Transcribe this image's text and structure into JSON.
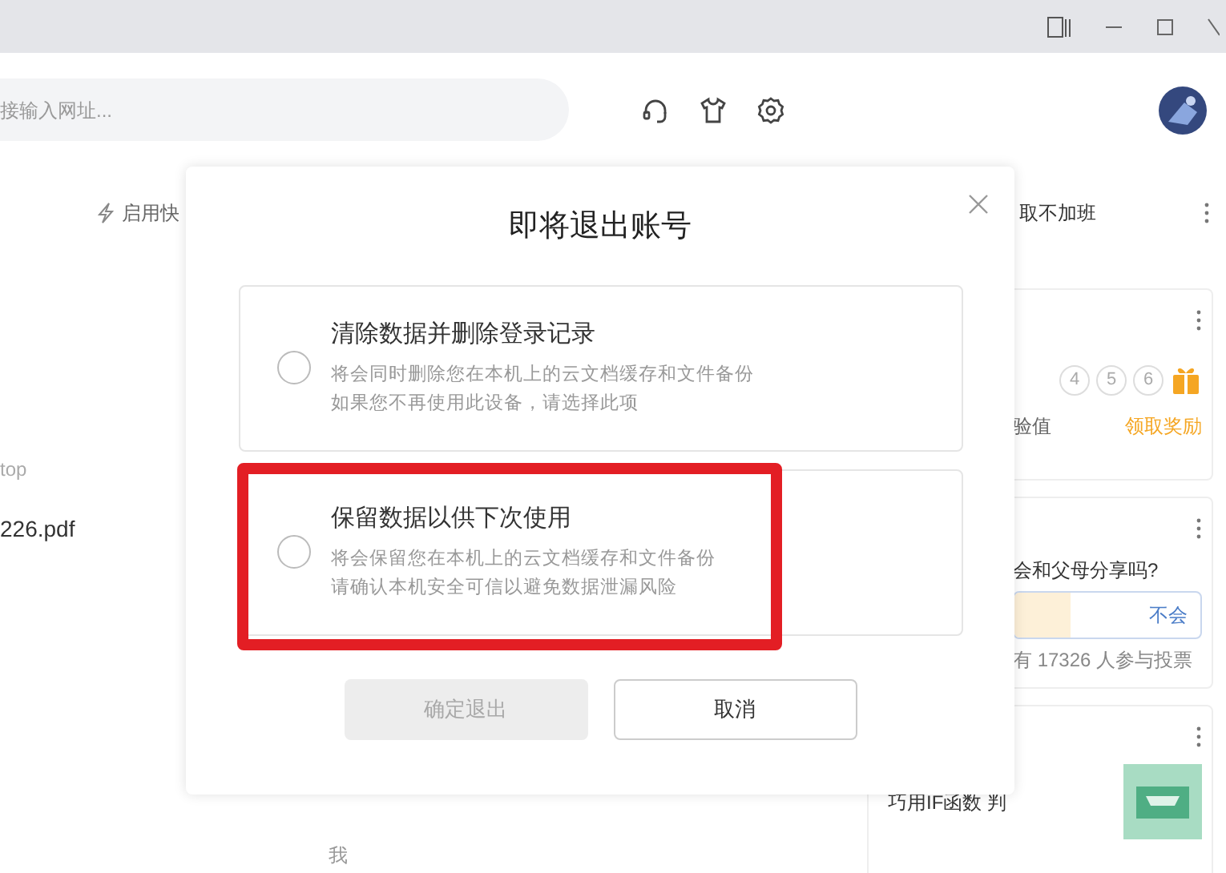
{
  "search": {
    "placeholder": "接输入网址..."
  },
  "background": {
    "quick_link": "启用快",
    "folder": "top",
    "file": "226.pdf",
    "owner": "我"
  },
  "right_panel": {
    "header": "取不加班",
    "checkin": {
      "steps": [
        {
          "label": "4"
        },
        {
          "label": "5"
        },
        {
          "label": "6"
        }
      ],
      "caption": "验值",
      "reward": "领取奖励"
    },
    "poll": {
      "question": "会和父母分享吗?",
      "option": "不会",
      "level": 0.3,
      "count": "有 17326 人参与投票"
    },
    "article": {
      "title": "巧用IF函数 判"
    }
  },
  "dialog": {
    "title": "即将退出账号",
    "options": [
      {
        "title": "清除数据并删除登录记录",
        "lines": [
          "将会同时删除您在本机上的云文档缓存和文件备份",
          "如果您不再使用此设备，请选择此项"
        ],
        "selected": false,
        "highlighted": false
      },
      {
        "title": "保留数据以供下次使用",
        "lines": [
          "将会保留您在本机上的云文档缓存和文件备份",
          "请确认本机安全可信以避免数据泄漏风险"
        ],
        "selected": false,
        "highlighted": true
      }
    ],
    "buttons": [
      {
        "label": "确定退出",
        "disabled": true
      },
      {
        "label": "取消",
        "disabled": false
      }
    ]
  }
}
